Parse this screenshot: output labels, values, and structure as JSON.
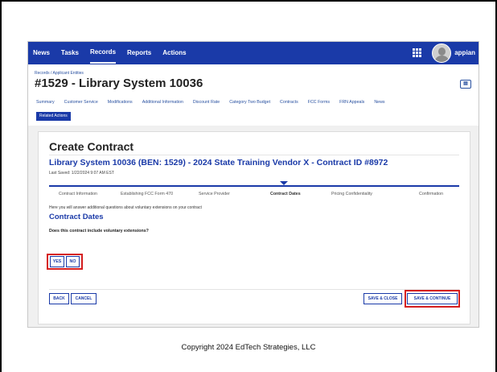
{
  "topnav": {
    "items": [
      "News",
      "Tasks",
      "Records",
      "Reports",
      "Actions"
    ],
    "active_index": 2,
    "brand": "appian"
  },
  "record": {
    "breadcrumb": "Records / Applicant Entities",
    "title": "#1529 - Library System 10036",
    "tabs": [
      "Summary",
      "Customer Service",
      "Modifications",
      "Additional Information",
      "Discount Rate",
      "Category Two Budget",
      "Contracts",
      "FCC Forms",
      "FRN Appeals",
      "News"
    ],
    "related_actions": "Related Actions"
  },
  "form": {
    "title": "Create Contract",
    "contract_title": "Library System 10036 (BEN: 1529) - 2024 State Training Vendor X - Contract ID #8972",
    "last_saved": "Last Saved: 1/22/2024 9:07 AM EST",
    "steps": [
      "Contract Information",
      "Establishing FCC Form 470",
      "Service Provider",
      "Contract Dates",
      "Pricing Confidentiality",
      "Confirmation"
    ],
    "current_step": 3,
    "instructions": "Here you will answer additional questions about voluntary extensions on your contract",
    "section_heading": "Contract Dates",
    "question": "Does this contract include voluntary extensions?",
    "yes_label": "YES",
    "no_label": "NO",
    "back_label": "BACK",
    "cancel_label": "CANCEL",
    "save_close_label": "SAVE & CLOSE",
    "save_continue_label": "SAVE & CONTINUE"
  },
  "copyright": "Copyright 2024 EdTech Strategies, LLC",
  "colors": {
    "nav_blue": "#1a3aa8",
    "highlight_red": "#d61f1f"
  }
}
